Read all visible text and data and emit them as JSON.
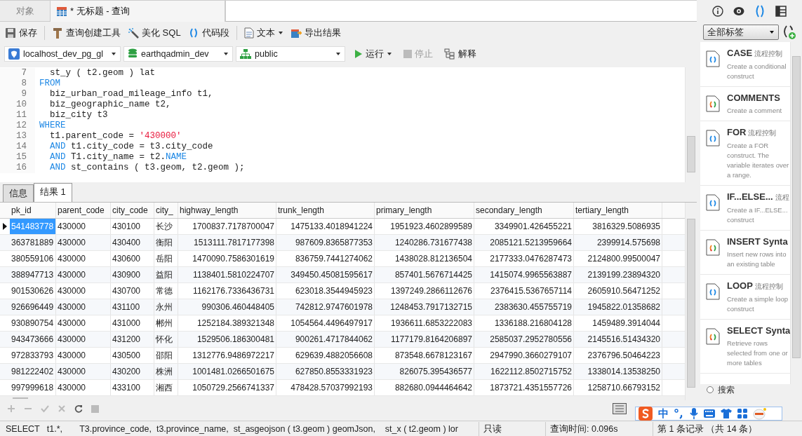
{
  "tabs": [
    {
      "label": "对象",
      "selected": false
    },
    {
      "label": "* 无标题 - 查询",
      "selected": true
    }
  ],
  "toolbar": [
    "保存",
    "查询创建工具",
    "美化 SQL",
    "代码段",
    "文本",
    "导出结果"
  ],
  "connection": {
    "server": "localhost_dev_pg_gl",
    "database": "earthqadmin_dev",
    "schema": "public",
    "run": "运行",
    "stop": "停止",
    "explain": "解释"
  },
  "editor_lines": [
    {
      "num": "7",
      "parts": [
        {
          "kind": "plain",
          "text": "  st_y ( t2.geom ) lat"
        }
      ]
    },
    {
      "num": "8",
      "parts": [
        {
          "kind": "kw",
          "text": "FROM"
        }
      ]
    },
    {
      "num": "9",
      "parts": [
        {
          "kind": "plain",
          "text": "  biz_urban_road_mileage_info t1,"
        }
      ]
    },
    {
      "num": "10",
      "parts": [
        {
          "kind": "plain",
          "text": "  biz_geographic_name t2,"
        }
      ]
    },
    {
      "num": "11",
      "parts": [
        {
          "kind": "plain",
          "text": "  biz_city t3"
        }
      ]
    },
    {
      "num": "12",
      "parts": [
        {
          "kind": "kw",
          "text": "WHERE"
        }
      ]
    },
    {
      "num": "13",
      "parts": [
        {
          "kind": "plain",
          "text": "  t1.parent_code = "
        },
        {
          "kind": "str",
          "text": "'430000'"
        }
      ]
    },
    {
      "num": "14",
      "parts": [
        {
          "kind": "kw",
          "text": "  AND"
        },
        {
          "kind": "plain",
          "text": " t1.city_code = t3.city_code"
        }
      ]
    },
    {
      "num": "15",
      "parts": [
        {
          "kind": "kw",
          "text": "  AND"
        },
        {
          "kind": "plain",
          "text": " T1.city_name = t2."
        },
        {
          "kind": "kw",
          "text": "NAME"
        }
      ]
    },
    {
      "num": "16",
      "parts": [
        {
          "kind": "kw",
          "text": "  AND"
        },
        {
          "kind": "plain",
          "text": " st_contains ( t3.geom, t2.geom );"
        }
      ]
    }
  ],
  "result_tabs": [
    {
      "label": "信息",
      "selected": false
    },
    {
      "label": "结果 1",
      "selected": true
    }
  ],
  "table": {
    "columns": [
      "pk_id",
      "parent_code",
      "city_code",
      "city_",
      "highway_length",
      "trunk_length",
      "primary_length",
      "secondary_length",
      "tertiary_length"
    ],
    "rows": [
      {
        "selected": true,
        "cells": [
          "541483778",
          "430000",
          "430100",
          "长沙",
          "1700837.7178700047",
          "1475133.4018941224",
          "1951923.4602899589",
          "3349901.426455221",
          "3816329.5086935"
        ]
      },
      {
        "selected": false,
        "cells": [
          "363781889",
          "430000",
          "430400",
          "衡阳",
          "1513111.7817177398",
          "987609.8365877353",
          "1240286.731677438",
          "2085121.5213959664",
          "2399914.575698"
        ]
      },
      {
        "selected": false,
        "cells": [
          "380559106",
          "430000",
          "430600",
          "岳阳",
          "1470090.7586301619",
          "836759.7441274062",
          "1438028.812136504",
          "2177333.0476287473",
          "2124800.99500047"
        ]
      },
      {
        "selected": false,
        "cells": [
          "388947713",
          "430000",
          "430900",
          "益阳",
          "1138401.5810224707",
          "349450.45081595617",
          "857401.5676714425",
          "1415074.9965563887",
          "2139199.23894320"
        ]
      },
      {
        "selected": false,
        "cells": [
          "901530626",
          "430000",
          "430700",
          "常德",
          "1162176.7336436731",
          "623018.3544945923",
          "1397249.2866112676",
          "2376415.5367657114",
          "2605910.56471252"
        ]
      },
      {
        "selected": false,
        "cells": [
          "926696449",
          "430000",
          "431100",
          "永州",
          "990306.460448405",
          "742812.9747601978",
          "1248453.7917132715",
          "2383630.455755719",
          "1945822.01358682"
        ]
      },
      {
        "selected": false,
        "cells": [
          "930890754",
          "430000",
          "431000",
          "郴州",
          "1252184.389321348",
          "1054564.4496497917",
          "1936611.6853222083",
          "1336188.216804128",
          "1459489.3914044"
        ]
      },
      {
        "selected": false,
        "cells": [
          "943473666",
          "430000",
          "431200",
          "怀化",
          "1529506.186300481",
          "900261.4717844062",
          "1177179.8164206897",
          "2585037.2952780556",
          "2145516.51434320"
        ]
      },
      {
        "selected": false,
        "cells": [
          "972833793",
          "430000",
          "430500",
          "邵阳",
          "1312776.9486972217",
          "629639.4882056608",
          "873548.6678123167",
          "2947990.3660279107",
          "2376796.50464223"
        ]
      },
      {
        "selected": false,
        "cells": [
          "981222402",
          "430000",
          "430200",
          "株洲",
          "1001481.0266501675",
          "627850.8553331923",
          "826075.395436577",
          "1622112.8502715752",
          "1338014.13538250"
        ]
      },
      {
        "selected": false,
        "cells": [
          "997999618",
          "430000",
          "433100",
          "湘西",
          "1050729.2566741337",
          "478428.57037992193",
          "882680.0944464642",
          "1873721.4351557726",
          "1258710.66793152"
        ]
      }
    ]
  },
  "status_bar": {
    "sql": "SELECT   t1.*,       T3.province_code,  t3.province_name,  st_asgeojson ( t3.geom ) geomJson,    st_x ( t2.geom ) lor",
    "mode": "只读",
    "time": "查询时间: 0.096s",
    "records": "第 1 条记录 （共 14 条）"
  },
  "snippets_panel": {
    "filter": "全部标签",
    "search_label": "搜索",
    "search_checked": false,
    "items": [
      {
        "kind": "flow",
        "title": "CASE",
        "tag": "流程控制",
        "desc": "Create a conditional construct"
      },
      {
        "kind": "general",
        "title": "COMMENTS",
        "desc": "Create a comment"
      },
      {
        "kind": "flow",
        "title": "FOR",
        "tag": "流程控制",
        "desc": "Create a FOR construct. The variable iterates over a range."
      },
      {
        "kind": "flow",
        "title": "IF...ELSE...",
        "tag": "流程",
        "desc": "Create a IF...ELSE... construct"
      },
      {
        "kind": "general",
        "title": "INSERT Synta",
        "desc": "Insert new rows into an existing table"
      },
      {
        "kind": "flow",
        "title": "LOOP",
        "tag": "流程控制",
        "desc": "Create a simple loop construct"
      },
      {
        "kind": "general",
        "title": "SELECT Synta",
        "desc": "Retrieve rows selected from one or more tables"
      }
    ]
  },
  "ime_bar": {
    "mode": "中"
  }
}
